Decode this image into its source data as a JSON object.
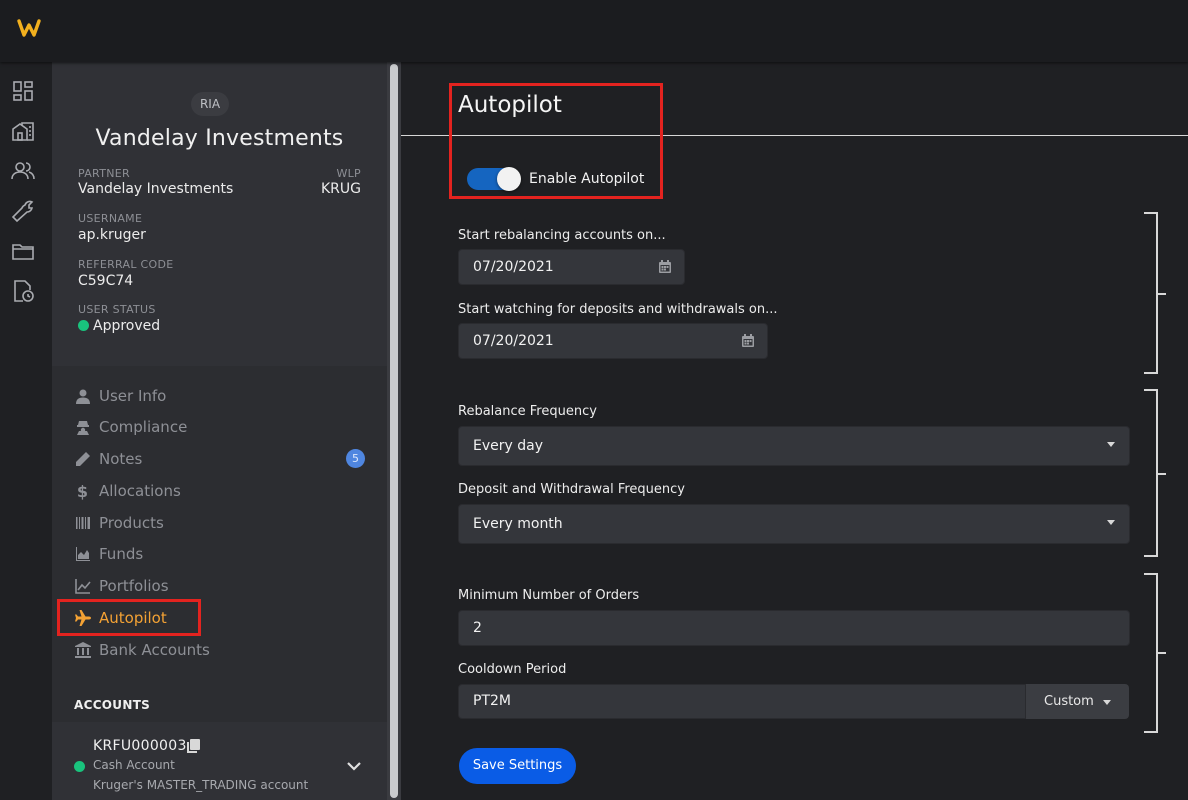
{
  "sidebar_profile": {
    "badge": "RIA",
    "name": "Vandelay Investments",
    "partner_label": "PARTNER",
    "partner_value": "Vandelay Investments",
    "wlp_label": "WLP",
    "wlp_value": "KRUG",
    "username_label": "USERNAME",
    "username_value": "ap.kruger",
    "referral_label": "REFERRAL CODE",
    "referral_value": "C59C74",
    "status_label": "USER STATUS",
    "status_value": "Approved"
  },
  "nav": {
    "items": [
      {
        "label": "User Info",
        "icon": "user-icon"
      },
      {
        "label": "Compliance",
        "icon": "compliance-icon"
      },
      {
        "label": "Notes",
        "icon": "pencil-icon",
        "badge": "5"
      },
      {
        "label": "Allocations",
        "icon": "dollar-icon"
      },
      {
        "label": "Products",
        "icon": "barcode-icon"
      },
      {
        "label": "Funds",
        "icon": "area-chart-icon"
      },
      {
        "label": "Portfolios",
        "icon": "line-chart-icon"
      },
      {
        "label": "Autopilot",
        "icon": "plane-icon",
        "active": true
      },
      {
        "label": "Bank Accounts",
        "icon": "bank-icon"
      }
    ]
  },
  "accounts": {
    "heading": "ACCOUNTS",
    "items": [
      {
        "id": "KRFU000003",
        "type": "Cash Account",
        "description": "Kruger's MASTER_TRADING account"
      }
    ]
  },
  "main": {
    "title": "Autopilot",
    "toggle_label": "Enable Autopilot",
    "toggle_on": true,
    "start_rebalancing_label": "Start rebalancing accounts on...",
    "start_rebalancing_value": "07/20/2021",
    "start_watching_label": "Start watching for deposits and withdrawals on...",
    "start_watching_value": "07/20/2021",
    "rebalance_freq_label": "Rebalance Frequency",
    "rebalance_freq_value": "Every day",
    "deposit_freq_label": "Deposit and Withdrawal Frequency",
    "deposit_freq_value": "Every month",
    "min_orders_label": "Minimum Number of Orders",
    "min_orders_value": "2",
    "cooldown_label": "Cooldown Period",
    "cooldown_value": "PT2M",
    "cooldown_unit": "Custom",
    "save_label": "Save Settings"
  },
  "colors": {
    "accent_active": "#f4a234",
    "toggle_on": "#1565c0",
    "primary_button": "#0a5ce6",
    "status_approved": "#19c37d",
    "highlight_box": "#e3231f",
    "badge": "#4f86e0"
  }
}
